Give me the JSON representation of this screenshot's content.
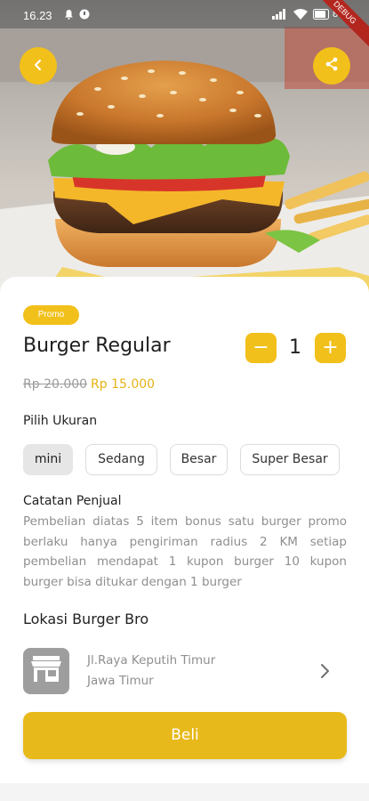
{
  "status_bar": {
    "time": "16.23",
    "battery": "80"
  },
  "debug_banner": "DEBUG",
  "product": {
    "badge": "Promo",
    "name": "Burger Regular",
    "price_old": "Rp 20.000",
    "price_new": "Rp 15.000",
    "quantity": "1",
    "minus_label": "−",
    "plus_label": "+"
  },
  "size": {
    "label": "Pilih Ukuran",
    "options": [
      "mini",
      "Sedang",
      "Besar",
      "Super Besar"
    ],
    "selected": "mini"
  },
  "notes": {
    "label": "Catatan Penjual",
    "text": "Pembelian diatas 5 item bonus satu burger promo berlaku hanya pengiriman radius 2 KM setiap pembelian mendapat 1 kupon burger 10 kupon burger bisa ditukar dengan 1 burger"
  },
  "location": {
    "label": "Lokasi Burger Bro",
    "line1": "Jl.Raya Keputih Timur",
    "line2": "Jawa Timur"
  },
  "buy_label": "Beli",
  "colors": {
    "accent": "#F2C01A",
    "button": "#E8B91A",
    "price_new": "#E5B316",
    "muted_text": "#8f8f8f"
  },
  "icons": {
    "back": "back-arrow-icon",
    "share": "share-icon",
    "store": "store-icon",
    "chevron": "chevron-right-icon"
  }
}
